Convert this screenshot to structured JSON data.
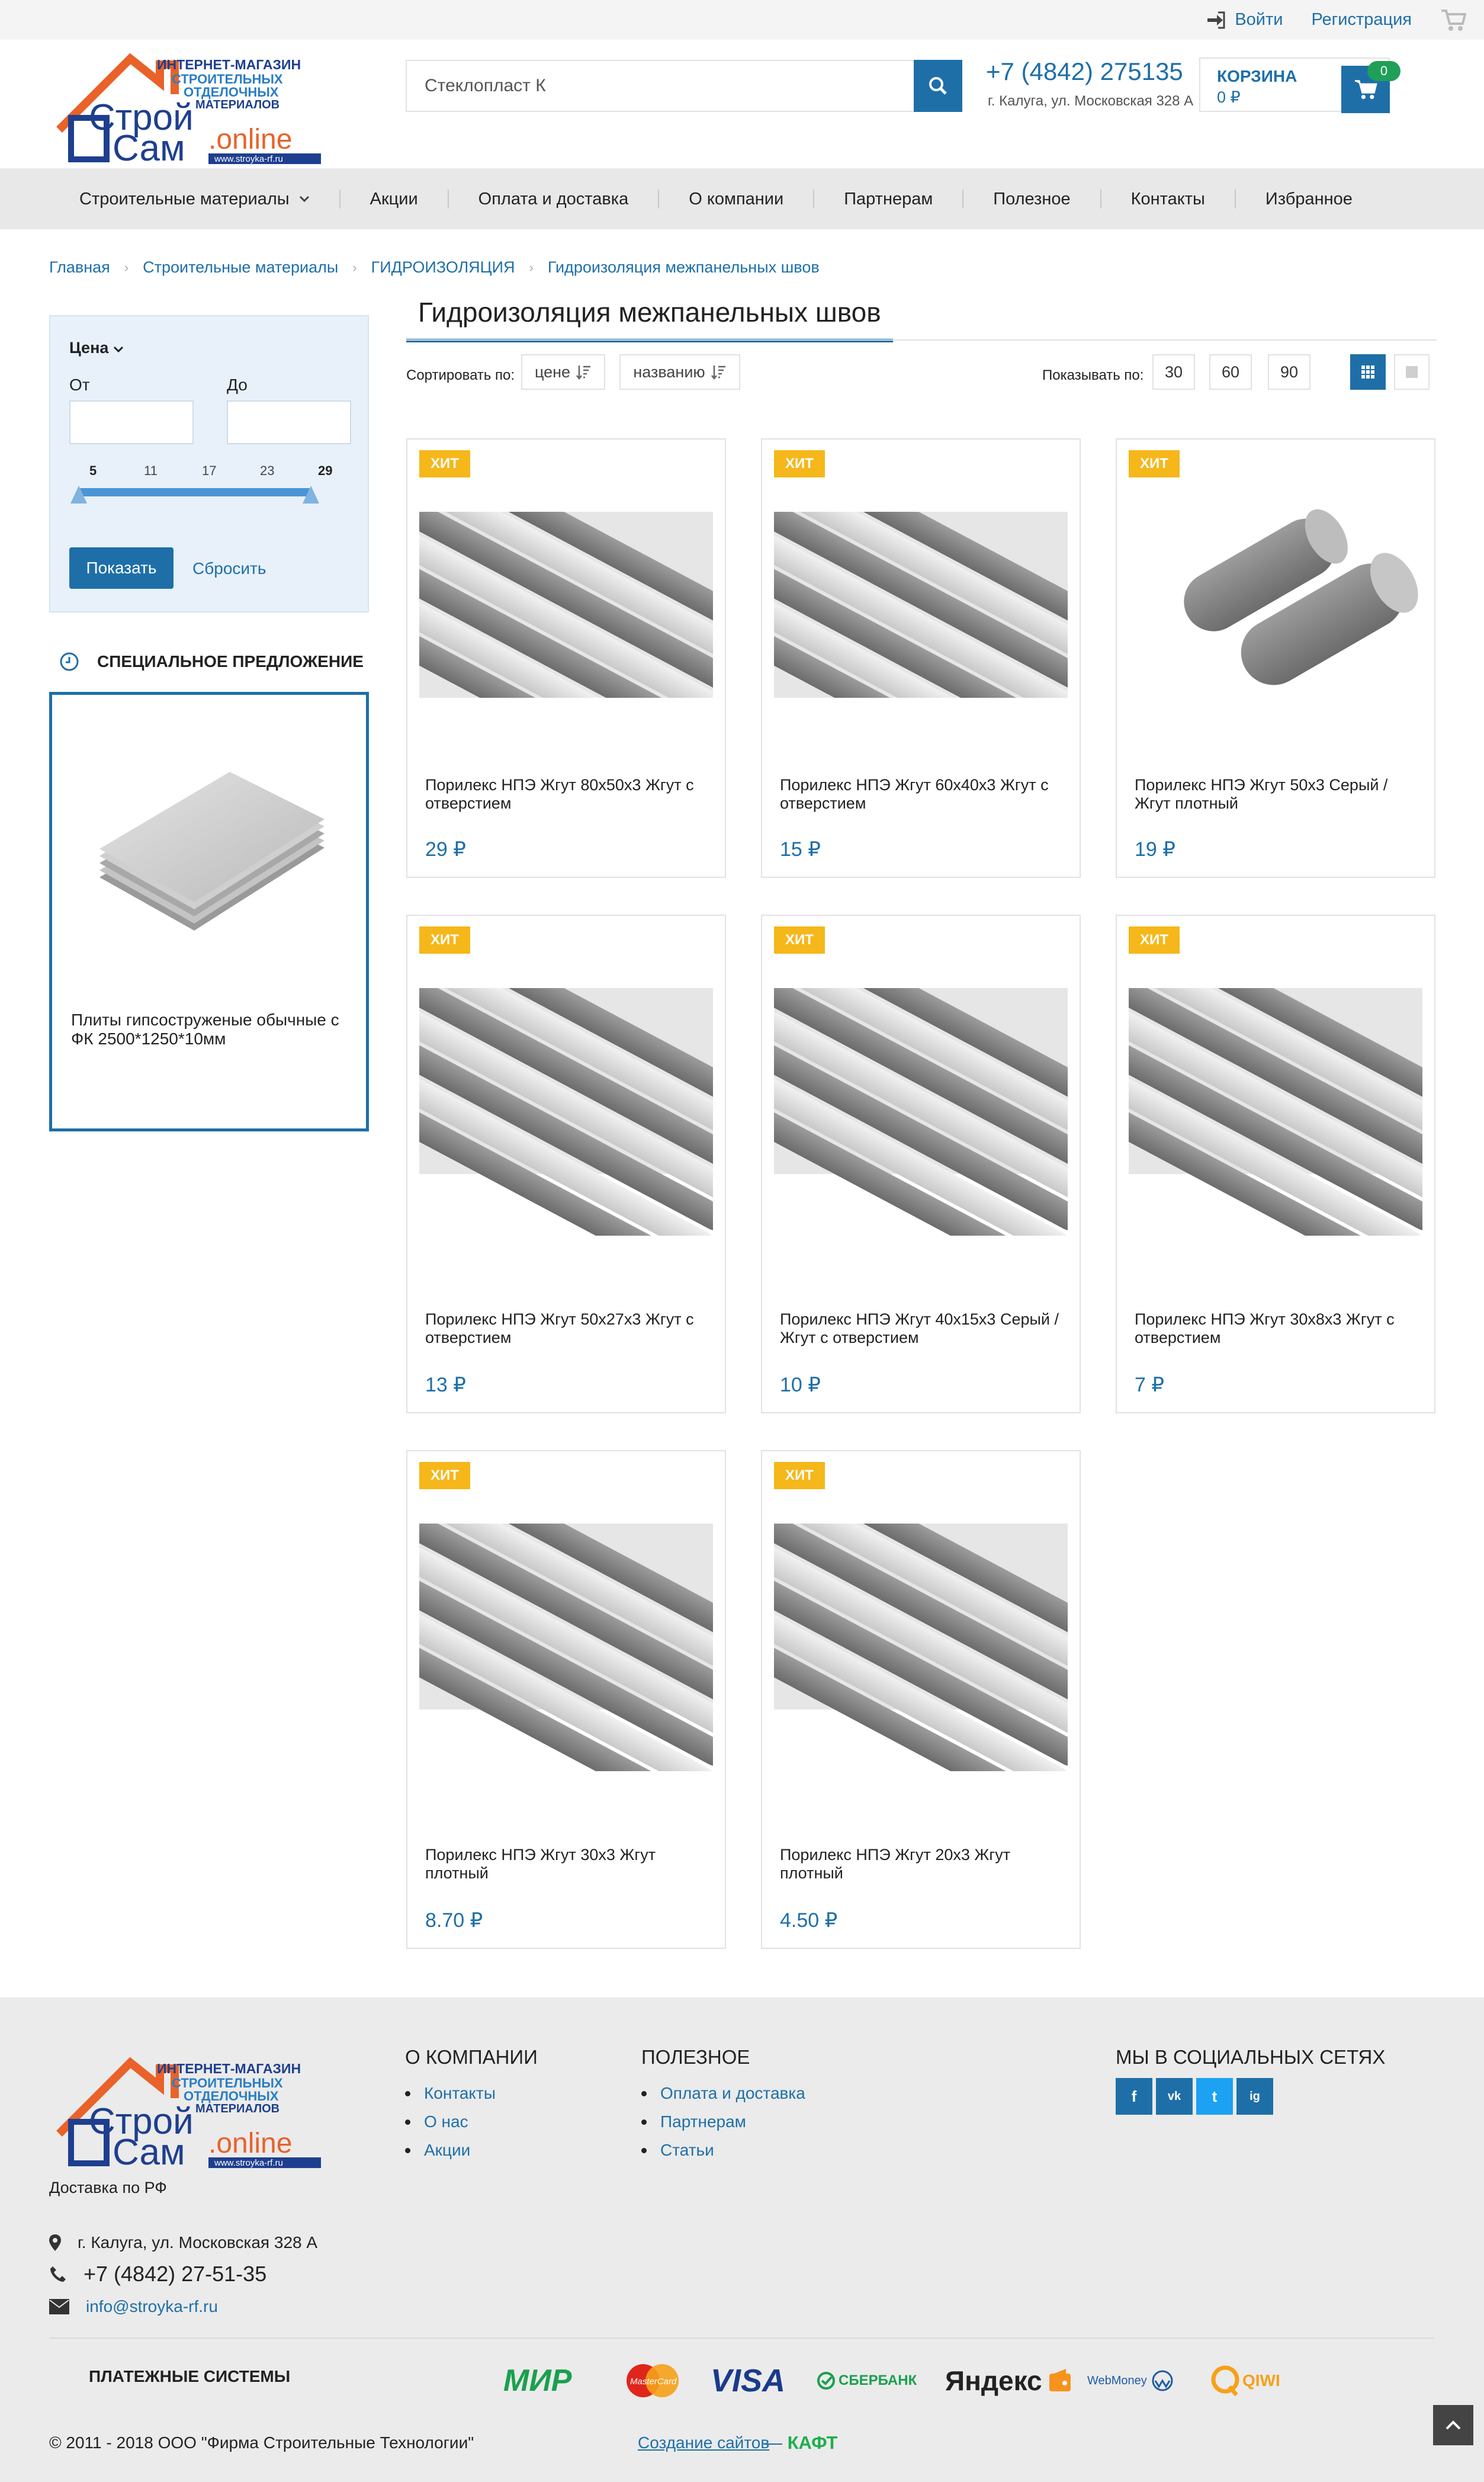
{
  "topbar": {
    "login": "Войти",
    "register": "Регистрация"
  },
  "logo": {
    "line1": "ИНТЕРНЕТ-МАГАЗИН",
    "line2": "СТРОИТЕЛЬНЫХ",
    "line3": "ОТДЕЛОЧНЫХ",
    "line4": "МАТЕРИАЛОВ",
    "word1": "Строй",
    "word2": "Сам",
    "suffix": ".online",
    "site": "www.stroyka-rf.ru"
  },
  "search": {
    "value": "Стеклопласт К"
  },
  "contacts": {
    "phone": "+7 (4842) 275135",
    "address": "г. Калуга, ул. Московская 328 А"
  },
  "cart": {
    "title": "КОРЗИНА",
    "sum": "0 ₽",
    "count": "0"
  },
  "nav": [
    "Строительные материалы",
    "Акции",
    "Оплата и доставка",
    "О компании",
    "Партнерам",
    "Полезное",
    "Контакты",
    "Избранное"
  ],
  "breadcrumb": [
    "Главная",
    "Строительные материалы",
    "ГИДРОИЗОЛЯЦИЯ",
    "Гидроизоляция межпанельных швов"
  ],
  "filter": {
    "title": "Цена",
    "from_label": "От",
    "to_label": "До",
    "ticks": [
      "5",
      "11",
      "17",
      "23",
      "29"
    ],
    "show": "Показать",
    "reset": "Сбросить"
  },
  "special": {
    "title": "СПЕЦИАЛЬНОЕ ПРЕДЛОЖЕНИЕ",
    "name": "Плиты гипсоструженые обычные с ФК 2500*1250*10мм"
  },
  "page_title": "Гидроизоляция межпанельных швов",
  "sort": {
    "label": "Сортировать по:",
    "by_price": "цене",
    "by_name": "названию",
    "show_label": "Показывать по:",
    "counts": [
      "30",
      "60",
      "90"
    ]
  },
  "badge": "ХИТ",
  "products": [
    {
      "name": "Порилекс НПЭ Жгут 80х50х3 Жгут с отверстием",
      "price": "29 ₽",
      "image": "tubes"
    },
    {
      "name": "Порилекс НПЭ Жгут 60х40х3 Жгут с отверстием",
      "price": "15 ₽",
      "image": "tubes"
    },
    {
      "name": "Порилекс НПЭ Жгут 50х3 Серый / Жгут плотный",
      "price": "19 ₽",
      "image": "rods"
    },
    {
      "name": "Порилекс НПЭ Жгут 50х27х3 Жгут с отверстием",
      "price": "13 ₽",
      "image": "tubes"
    },
    {
      "name": "Порилекс НПЭ Жгут 40х15х3 Серый / Жгут с отверстием",
      "price": "10 ₽",
      "image": "tubes"
    },
    {
      "name": "Порилекс НПЭ Жгут 30х8х3 Жгут с отверстием",
      "price": "7 ₽",
      "image": "tubes"
    },
    {
      "name": "Порилекс НПЭ Жгут 30х3 Жгут плотный",
      "price": "8.70 ₽",
      "image": "tubes"
    },
    {
      "name": "Порилекс НПЭ Жгут 20х3 Жгут плотный",
      "price": "4.50 ₽",
      "image": "tubes"
    }
  ],
  "footer": {
    "delivery": "Доставка по РФ",
    "company_title": "О КОМПАНИИ",
    "company_links": [
      "Контакты",
      "О нас",
      "Акции"
    ],
    "useful_title": "ПОЛЕЗНОЕ",
    "useful_links": [
      "Оплата и доставка",
      "Партнерам",
      "Статьи"
    ],
    "social_title": "МЫ В СОЦИАЛЬНЫХ СЕТЯХ",
    "social": [
      "f",
      "vk",
      "t",
      "ig"
    ],
    "address": "г. Калуга, ул. Московская 328 А",
    "phone": "+7 (4842) 27-51-35",
    "email": "info@stroyka-rf.ru",
    "payments_title": "ПЛАТЕЖНЫЕ СИСТЕМЫ",
    "payments": {
      "mir": "МИР",
      "mastercard": "MasterCard",
      "visa": "VISA",
      "sber": "СБЕРБАНК",
      "yandex": "Яндекс",
      "webmoney": "WebMoney",
      "qiwi": "QIWI"
    },
    "copyright": "© 2011 - 2018 ООО \"Фирма Строительные Технологии\"",
    "created": "Создание сайтов",
    "dash": "—",
    "kaft": "КАФТ"
  }
}
